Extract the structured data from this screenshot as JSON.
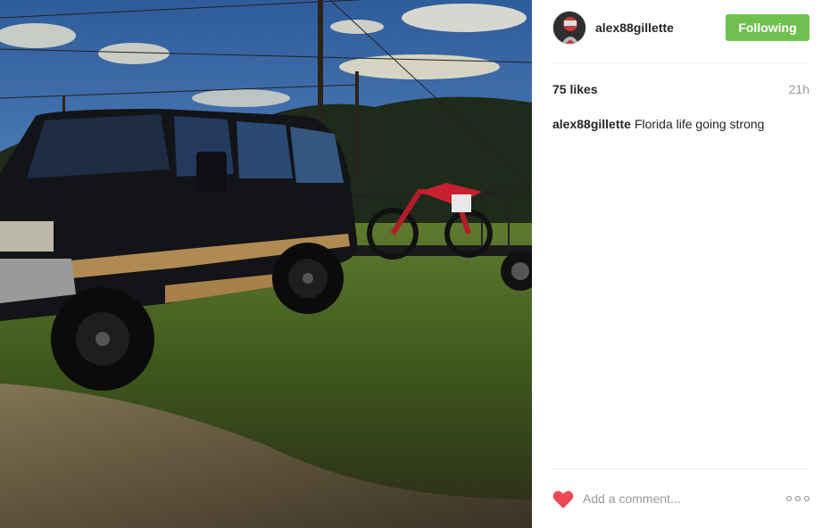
{
  "post": {
    "image_alt": "Black SUV towing a trailer with dirt bikes on grass",
    "username": "alex88gillette",
    "follow_button": "Following",
    "likes": "75 likes",
    "time": "21h",
    "caption_user": "alex88gillette",
    "caption_text": "Florida life going strong"
  },
  "comment": {
    "placeholder": "Add a comment..."
  },
  "icons": {
    "like": "heart-icon",
    "more": "more-options-icon"
  },
  "colors": {
    "follow_button": "#70c050",
    "heart": "#ed4956"
  }
}
